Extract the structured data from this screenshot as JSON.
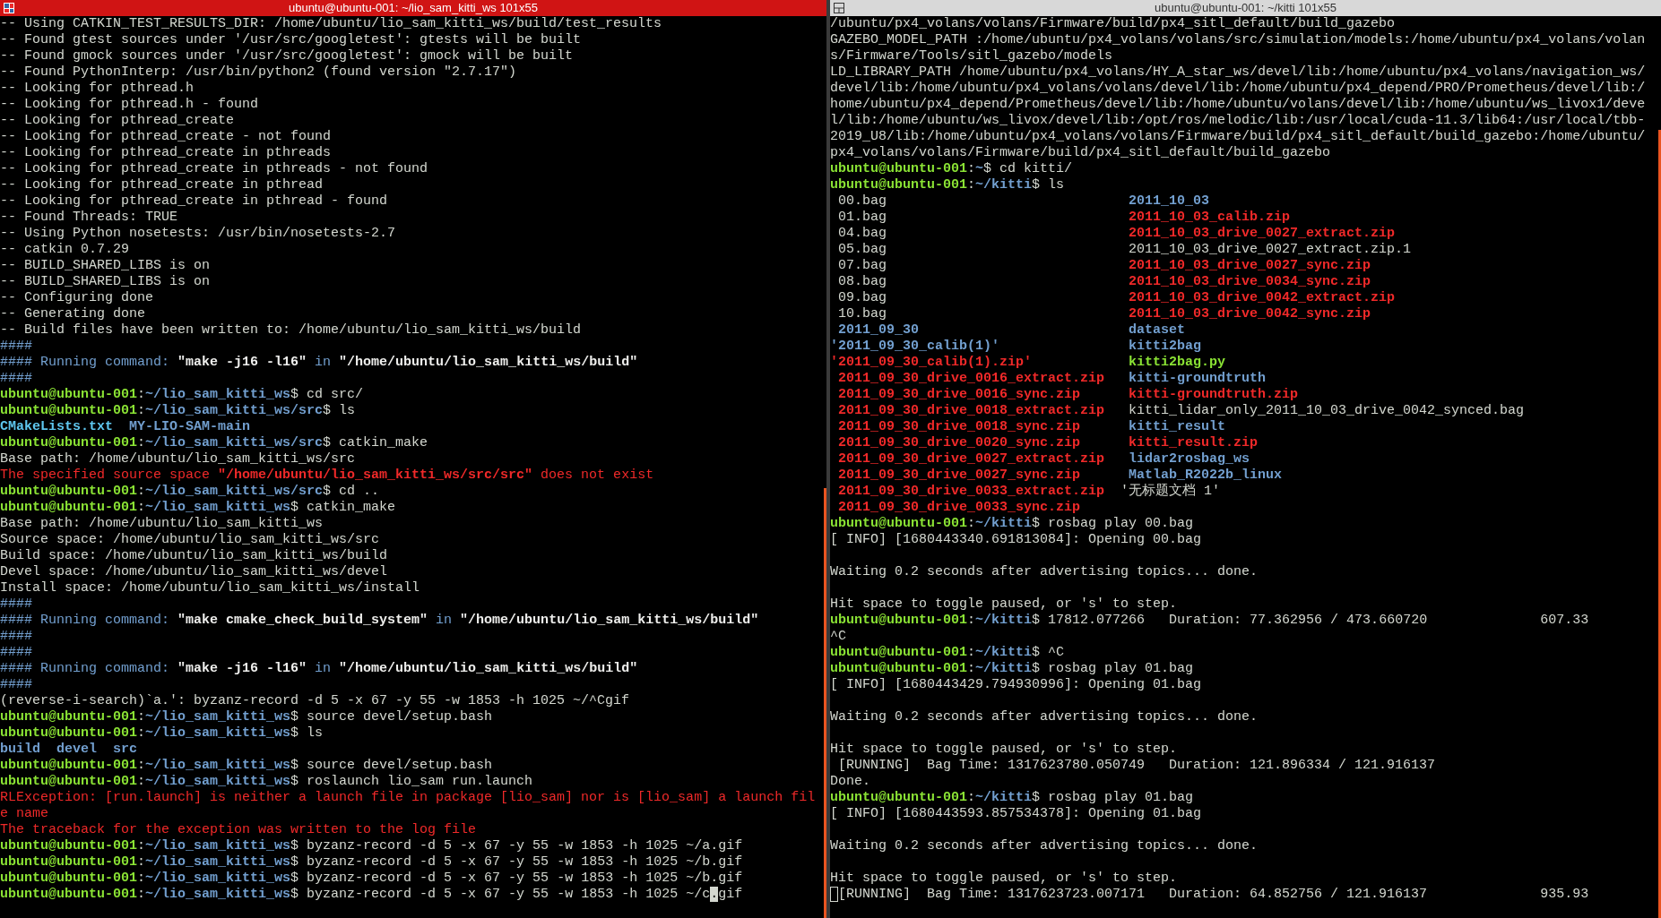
{
  "panes": [
    {
      "title": "ubuntu@ubuntu-001: ~/lio_sam_kitti_ws 101x55",
      "focused": true,
      "lines": [
        {
          "kind": "text",
          "segments": [
            {
              "text": "-- Using CATKIN_TEST_RESULTS_DIR: /home/ubuntu/lio_sam_kitti_ws/build/test_results",
              "kind": "plain"
            }
          ]
        },
        {
          "kind": "text",
          "segments": [
            {
              "text": "-- Found gtest sources under '/usr/src/googletest': gtests will be built",
              "kind": "plain"
            }
          ]
        },
        {
          "kind": "text",
          "segments": [
            {
              "text": "-- Found gmock sources under '/usr/src/googletest': gmock will be built",
              "kind": "plain"
            }
          ]
        },
        {
          "kind": "text",
          "segments": [
            {
              "text": "-- Found PythonInterp: /usr/bin/python2 (found version \"2.7.17\")",
              "kind": "plain"
            }
          ]
        },
        {
          "kind": "text",
          "segments": [
            {
              "text": "-- Looking for pthread.h",
              "kind": "plain"
            }
          ]
        },
        {
          "kind": "text",
          "segments": [
            {
              "text": "-- Looking for pthread.h - found",
              "kind": "plain"
            }
          ]
        },
        {
          "kind": "text",
          "segments": [
            {
              "text": "-- Looking for pthread_create",
              "kind": "plain"
            }
          ]
        },
        {
          "kind": "text",
          "segments": [
            {
              "text": "-- Looking for pthread_create - not found",
              "kind": "plain"
            }
          ]
        },
        {
          "kind": "text",
          "segments": [
            {
              "text": "-- Looking for pthread_create in pthreads",
              "kind": "plain"
            }
          ]
        },
        {
          "kind": "text",
          "segments": [
            {
              "text": "-- Looking for pthread_create in pthreads - not found",
              "kind": "plain"
            }
          ]
        },
        {
          "kind": "text",
          "segments": [
            {
              "text": "-- Looking for pthread_create in pthread",
              "kind": "plain"
            }
          ]
        },
        {
          "kind": "text",
          "segments": [
            {
              "text": "-- Looking for pthread_create in pthread - found",
              "kind": "plain"
            }
          ]
        },
        {
          "kind": "text",
          "segments": [
            {
              "text": "-- Found Threads: TRUE",
              "kind": "plain"
            }
          ]
        },
        {
          "kind": "text",
          "segments": [
            {
              "text": "-- Using Python nosetests: /usr/bin/nosetests-2.7",
              "kind": "plain"
            }
          ]
        },
        {
          "kind": "text",
          "segments": [
            {
              "text": "-- catkin 0.7.29",
              "kind": "plain"
            }
          ]
        },
        {
          "kind": "text",
          "segments": [
            {
              "text": "-- BUILD_SHARED_LIBS is on",
              "kind": "plain"
            }
          ]
        },
        {
          "kind": "text",
          "segments": [
            {
              "text": "-- BUILD_SHARED_LIBS is on",
              "kind": "plain"
            }
          ]
        },
        {
          "kind": "text",
          "segments": [
            {
              "text": "-- Configuring done",
              "kind": "plain"
            }
          ]
        },
        {
          "kind": "text",
          "segments": [
            {
              "text": "-- Generating done",
              "kind": "plain"
            }
          ]
        },
        {
          "kind": "text",
          "segments": [
            {
              "text": "-- Build files have been written to: /home/ubuntu/lio_sam_kitti_ws/build",
              "kind": "plain"
            }
          ]
        },
        {
          "kind": "text",
          "segments": [
            {
              "text": "####",
              "kind": "info"
            }
          ]
        },
        {
          "kind": "text",
          "segments": [
            {
              "text": "#### Running command: ",
              "kind": "info"
            },
            {
              "text": "\"make -j16 -l16\"",
              "kind": "strong"
            },
            {
              "text": " in ",
              "kind": "info"
            },
            {
              "text": "\"/home/ubuntu/lio_sam_kitti_ws/build\"",
              "kind": "strong"
            }
          ]
        },
        {
          "kind": "text",
          "segments": [
            {
              "text": "####",
              "kind": "info"
            }
          ]
        },
        {
          "kind": "prompt",
          "user": "ubuntu@ubuntu-001",
          "separator": ":",
          "path": "~/lio_sam_kitti_ws",
          "command": "$ cd src/"
        },
        {
          "kind": "prompt",
          "user": "ubuntu@ubuntu-001",
          "separator": ":",
          "path": "~/lio_sam_kitti_ws/src",
          "command": "$ ls"
        },
        {
          "kind": "text",
          "segments": [
            {
              "text": "CMakeLists.txt",
              "kind": "file"
            },
            {
              "text": "  MY-LIO-SAM-main",
              "kind": "dir"
            }
          ]
        },
        {
          "kind": "prompt",
          "user": "ubuntu@ubuntu-001",
          "separator": ":",
          "path": "~/lio_sam_kitti_ws/src",
          "command": "$ catkin_make"
        },
        {
          "kind": "text",
          "segments": [
            {
              "text": "Base path: /home/ubuntu/lio_sam_kitti_ws/src",
              "kind": "plain"
            }
          ]
        },
        {
          "kind": "text",
          "segments": [
            {
              "text": "The specified source space ",
              "kind": "error"
            },
            {
              "text": "\"/home/ubuntu/lio_sam_kitti_ws/src/src\"",
              "kind": "error_bold"
            },
            {
              "text": " does not exist",
              "kind": "error"
            }
          ]
        },
        {
          "kind": "prompt",
          "user": "ubuntu@ubuntu-001",
          "separator": ":",
          "path": "~/lio_sam_kitti_ws/src",
          "command": "$ cd .."
        },
        {
          "kind": "prompt",
          "user": "ubuntu@ubuntu-001",
          "separator": ":",
          "path": "~/lio_sam_kitti_ws",
          "command": "$ catkin_make"
        },
        {
          "kind": "text",
          "segments": [
            {
              "text": "Base path: /home/ubuntu/lio_sam_kitti_ws",
              "kind": "plain"
            }
          ]
        },
        {
          "kind": "text",
          "segments": [
            {
              "text": "Source space: /home/ubuntu/lio_sam_kitti_ws/src",
              "kind": "plain"
            }
          ]
        },
        {
          "kind": "text",
          "segments": [
            {
              "text": "Build space: /home/ubuntu/lio_sam_kitti_ws/build",
              "kind": "plain"
            }
          ]
        },
        {
          "kind": "text",
          "segments": [
            {
              "text": "Devel space: /home/ubuntu/lio_sam_kitti_ws/devel",
              "kind": "plain"
            }
          ]
        },
        {
          "kind": "text",
          "segments": [
            {
              "text": "Install space: /home/ubuntu/lio_sam_kitti_ws/install",
              "kind": "plain"
            }
          ]
        },
        {
          "kind": "text",
          "segments": [
            {
              "text": "####",
              "kind": "info"
            }
          ]
        },
        {
          "kind": "text",
          "segments": [
            {
              "text": "#### Running command: ",
              "kind": "info"
            },
            {
              "text": "\"make cmake_check_build_system\"",
              "kind": "strong"
            },
            {
              "text": " in ",
              "kind": "info"
            },
            {
              "text": "\"/home/ubuntu/lio_sam_kitti_ws/build\"",
              "kind": "strong"
            }
          ]
        },
        {
          "kind": "text",
          "segments": [
            {
              "text": "####",
              "kind": "info"
            }
          ]
        },
        {
          "kind": "text",
          "segments": [
            {
              "text": "####",
              "kind": "info"
            }
          ]
        },
        {
          "kind": "text",
          "segments": [
            {
              "text": "#### Running command: ",
              "kind": "info"
            },
            {
              "text": "\"make -j16 -l16\"",
              "kind": "strong"
            },
            {
              "text": " in ",
              "kind": "info"
            },
            {
              "text": "\"/home/ubuntu/lio_sam_kitti_ws/build\"",
              "kind": "strong"
            }
          ]
        },
        {
          "kind": "text",
          "segments": [
            {
              "text": "####",
              "kind": "info"
            }
          ]
        },
        {
          "kind": "text",
          "segments": [
            {
              "text": "(reverse-i-search)`a.': byzanz-record -d 5 -x 67 -y 55 -w 1853 -h 1025 ~/^Cgif",
              "kind": "plain"
            }
          ]
        },
        {
          "kind": "prompt",
          "user": "ubuntu@ubuntu-001",
          "separator": ":",
          "path": "~/lio_sam_kitti_ws",
          "command": "$ source devel/setup.bash"
        },
        {
          "kind": "prompt",
          "user": "ubuntu@ubuntu-001",
          "separator": ":",
          "path": "~/lio_sam_kitti_ws",
          "command": "$ ls"
        },
        {
          "kind": "text",
          "segments": [
            {
              "text": "build  devel  src",
              "kind": "dir"
            }
          ]
        },
        {
          "kind": "prompt",
          "user": "ubuntu@ubuntu-001",
          "separator": ":",
          "path": "~/lio_sam_kitti_ws",
          "command": "$ source devel/setup.bash"
        },
        {
          "kind": "prompt",
          "user": "ubuntu@ubuntu-001",
          "separator": ":",
          "path": "~/lio_sam_kitti_ws",
          "command": "$ roslaunch lio_sam run.launch"
        },
        {
          "kind": "text",
          "segments": [
            {
              "text": "RLException: [run.launch] is neither a launch file in package [lio_sam] nor is [lio_sam] a launch fil",
              "kind": "error"
            }
          ]
        },
        {
          "kind": "text",
          "segments": [
            {
              "text": "e name",
              "kind": "error"
            }
          ]
        },
        {
          "kind": "text",
          "segments": [
            {
              "text": "The traceback for the exception was written to the log file",
              "kind": "error"
            }
          ]
        },
        {
          "kind": "prompt",
          "user": "ubuntu@ubuntu-001",
          "separator": ":",
          "path": "~/lio_sam_kitti_ws",
          "command": "$ byzanz-record -d 5 -x 67 -y 55 -w 1853 -h 1025 ~/a.gif"
        },
        {
          "kind": "prompt",
          "user": "ubuntu@ubuntu-001",
          "separator": ":",
          "path": "~/lio_sam_kitti_ws",
          "command": "$ byzanz-record -d 5 -x 67 -y 55 -w 1853 -h 1025 ~/b.gif"
        },
        {
          "kind": "prompt",
          "user": "ubuntu@ubuntu-001",
          "separator": ":",
          "path": "~/lio_sam_kitti_ws",
          "command": "$ byzanz-record -d 5 -x 67 -y 55 -w 1853 -h 1025 ~/b.gif"
        },
        {
          "kind": "prompt",
          "user": "ubuntu@ubuntu-001",
          "separator": ":",
          "path": "~/lio_sam_kitti_ws",
          "command": "$ byzanz-record -d 5 -x 67 -y 55 -w 1853 -h 1025 ~/c",
          "cursor": ".",
          "after": "gif"
        }
      ]
    },
    {
      "title": "ubuntu@ubuntu-001: ~/kitti 101x55",
      "focused": false,
      "lines": [
        {
          "kind": "text",
          "segments": [
            {
              "text": "/ubuntu/px4_volans/volans/Firmware/build/px4_sitl_default/build_gazebo",
              "kind": "plain"
            }
          ]
        },
        {
          "kind": "text",
          "segments": [
            {
              "text": "GAZEBO_MODEL_PATH :/home/ubuntu/px4_volans/volans/src/simulation/models:/home/ubuntu/px4_volans/volan",
              "kind": "plain"
            }
          ]
        },
        {
          "kind": "text",
          "segments": [
            {
              "text": "s/Firmware/Tools/sitl_gazebo/models",
              "kind": "plain"
            }
          ]
        },
        {
          "kind": "text",
          "segments": [
            {
              "text": "LD_LIBRARY_PATH /home/ubuntu/px4_volans/HY_A_star_ws/devel/lib:/home/ubuntu/px4_volans/navigation_ws/",
              "kind": "plain"
            }
          ]
        },
        {
          "kind": "text",
          "segments": [
            {
              "text": "devel/lib:/home/ubuntu/px4_volans/volans/devel/lib:/home/ubuntu/px4_depend/PRO/Prometheus/devel/lib:/",
              "kind": "plain"
            }
          ]
        },
        {
          "kind": "text",
          "segments": [
            {
              "text": "home/ubuntu/px4_depend/Prometheus/devel/lib:/home/ubuntu/volans/devel/lib:/home/ubuntu/ws_livox1/deve",
              "kind": "plain"
            }
          ]
        },
        {
          "kind": "text",
          "segments": [
            {
              "text": "l/lib:/home/ubuntu/ws_livox/devel/lib:/opt/ros/melodic/lib:/usr/local/cuda-11.3/lib64:/usr/local/tbb-",
              "kind": "plain"
            }
          ]
        },
        {
          "kind": "text",
          "segments": [
            {
              "text": "2019_U8/lib:/home/ubuntu/px4_volans/volans/Firmware/build/px4_sitl_default/build_gazebo:/home/ubuntu/",
              "kind": "plain"
            }
          ]
        },
        {
          "kind": "text",
          "segments": [
            {
              "text": "px4_volans/volans/Firmware/build/px4_sitl_default/build_gazebo",
              "kind": "plain"
            }
          ]
        },
        {
          "kind": "prompt",
          "user": "ubuntu@ubuntu-001",
          "separator": ":",
          "path": "~",
          "command": "$ cd kitti/"
        },
        {
          "kind": "prompt",
          "user": "ubuntu@ubuntu-001",
          "separator": ":",
          "path": "~/kitti",
          "command": "$ ls"
        },
        {
          "kind": "ls",
          "left": {
            "text": " 00.bag",
            "kind": "plain"
          },
          "right": {
            "text": " 2011_10_03",
            "kind": "dir"
          }
        },
        {
          "kind": "ls",
          "left": {
            "text": " 01.bag",
            "kind": "plain"
          },
          "right": {
            "text": " 2011_10_03_calib.zip",
            "kind": "zip"
          }
        },
        {
          "kind": "ls",
          "left": {
            "text": " 04.bag",
            "kind": "plain"
          },
          "right": {
            "text": " 2011_10_03_drive_0027_extract.zip",
            "kind": "zip"
          }
        },
        {
          "kind": "ls",
          "left": {
            "text": " 05.bag",
            "kind": "plain"
          },
          "right": {
            "text": " 2011_10_03_drive_0027_extract.zip.1",
            "kind": "plain"
          }
        },
        {
          "kind": "ls",
          "left": {
            "text": " 07.bag",
            "kind": "plain"
          },
          "right": {
            "text": " 2011_10_03_drive_0027_sync.zip",
            "kind": "zip"
          }
        },
        {
          "kind": "ls",
          "left": {
            "text": " 08.bag",
            "kind": "plain"
          },
          "right": {
            "text": " 2011_10_03_drive_0034_sync.zip",
            "kind": "zip"
          }
        },
        {
          "kind": "ls",
          "left": {
            "text": " 09.bag",
            "kind": "plain"
          },
          "right": {
            "text": " 2011_10_03_drive_0042_extract.zip",
            "kind": "zip"
          }
        },
        {
          "kind": "ls",
          "left": {
            "text": " 10.bag",
            "kind": "plain"
          },
          "right": {
            "text": " 2011_10_03_drive_0042_sync.zip",
            "kind": "zip"
          }
        },
        {
          "kind": "ls",
          "left": {
            "text": " 2011_09_30",
            "kind": "dir"
          },
          "right": {
            "text": " dataset",
            "kind": "dir"
          }
        },
        {
          "kind": "ls",
          "left": {
            "text": "'2011_09_30_calib(1)'",
            "kind": "dir"
          },
          "right": {
            "text": " kitti2bag",
            "kind": "dir"
          }
        },
        {
          "kind": "ls",
          "left": {
            "text": "'2011_09_30_calib(1).zip'",
            "kind": "zip"
          },
          "right": {
            "text": " kitti2bag.py",
            "kind": "exec"
          }
        },
        {
          "kind": "ls",
          "left": {
            "text": " 2011_09_30_drive_0016_extract.zip",
            "kind": "zip"
          },
          "right": {
            "text": " kitti-groundtruth",
            "kind": "dir"
          }
        },
        {
          "kind": "ls",
          "left": {
            "text": " 2011_09_30_drive_0016_sync.zip",
            "kind": "zip"
          },
          "right": {
            "text": " kitti-groundtruth.zip",
            "kind": "zip"
          }
        },
        {
          "kind": "ls",
          "left": {
            "text": " 2011_09_30_drive_0018_extract.zip",
            "kind": "zip"
          },
          "right": {
            "text": " kitti_lidar_only_2011_10_03_drive_0042_synced.bag",
            "kind": "plain"
          }
        },
        {
          "kind": "ls",
          "left": {
            "text": " 2011_09_30_drive_0018_sync.zip",
            "kind": "zip"
          },
          "right": {
            "text": " kitti_result",
            "kind": "dir"
          }
        },
        {
          "kind": "ls",
          "left": {
            "text": " 2011_09_30_drive_0020_sync.zip",
            "kind": "zip"
          },
          "right": {
            "text": " kitti_result.zip",
            "kind": "zip"
          }
        },
        {
          "kind": "ls",
          "left": {
            "text": " 2011_09_30_drive_0027_extract.zip",
            "kind": "zip"
          },
          "right": {
            "text": " lidar2rosbag_ws",
            "kind": "dir"
          }
        },
        {
          "kind": "ls",
          "left": {
            "text": " 2011_09_30_drive_0027_sync.zip",
            "kind": "zip"
          },
          "right": {
            "text": " Matlab_R2022b_linux",
            "kind": "dir"
          }
        },
        {
          "kind": "ls",
          "left": {
            "text": " 2011_09_30_drive_0033_extract.zip",
            "kind": "zip"
          },
          "right": {
            "text": "'无标题文档 1'",
            "kind": "plain"
          }
        },
        {
          "kind": "ls",
          "left": {
            "text": " 2011_09_30_drive_0033_sync.zip",
            "kind": "zip"
          }
        },
        {
          "kind": "prompt",
          "user": "ubuntu@ubuntu-001",
          "separator": ":",
          "path": "~/kitti",
          "command": "$ rosbag play 00.bag"
        },
        {
          "kind": "text",
          "segments": [
            {
              "text": "[ INFO] [1680443340.691813084]: Opening 00.bag",
              "kind": "plain"
            }
          ]
        },
        {
          "kind": "blank"
        },
        {
          "kind": "text",
          "segments": [
            {
              "text": "Waiting 0.2 seconds after advertising topics... done.",
              "kind": "plain"
            }
          ]
        },
        {
          "kind": "blank"
        },
        {
          "kind": "text",
          "segments": [
            {
              "text": "Hit space to toggle paused, or 's' to step.",
              "kind": "plain"
            }
          ]
        },
        {
          "kind": "prompt",
          "user": "ubuntu@ubuntu-001",
          "separator": ":",
          "path": "~/kitti",
          "command": "$ 17812.077266   Duration: 77.362956 / 473.660720              607.33"
        },
        {
          "kind": "text",
          "segments": [
            {
              "text": "^C",
              "kind": "plain"
            }
          ]
        },
        {
          "kind": "prompt",
          "user": "ubuntu@ubuntu-001",
          "separator": ":",
          "path": "~/kitti",
          "command": "$ ^C"
        },
        {
          "kind": "prompt",
          "user": "ubuntu@ubuntu-001",
          "separator": ":",
          "path": "~/kitti",
          "command": "$ rosbag play 01.bag"
        },
        {
          "kind": "text",
          "segments": [
            {
              "text": "[ INFO] [1680443429.794930996]: Opening 01.bag",
              "kind": "plain"
            }
          ]
        },
        {
          "kind": "blank"
        },
        {
          "kind": "text",
          "segments": [
            {
              "text": "Waiting 0.2 seconds after advertising topics... done.",
              "kind": "plain"
            }
          ]
        },
        {
          "kind": "blank"
        },
        {
          "kind": "text",
          "segments": [
            {
              "text": "Hit space to toggle paused, or 's' to step.",
              "kind": "plain"
            }
          ]
        },
        {
          "kind": "text",
          "segments": [
            {
              "text": " [RUNNING]  Bag Time: 1317623780.050749   Duration: 121.896334 / 121.916137",
              "kind": "plain"
            }
          ]
        },
        {
          "kind": "text",
          "segments": [
            {
              "text": "Done.",
              "kind": "plain"
            }
          ]
        },
        {
          "kind": "prompt",
          "user": "ubuntu@ubuntu-001",
          "separator": ":",
          "path": "~/kitti",
          "command": "$ rosbag play 01.bag"
        },
        {
          "kind": "text",
          "segments": [
            {
              "text": "[ INFO] [1680443593.857534378]: Opening 01.bag",
              "kind": "plain"
            }
          ]
        },
        {
          "kind": "blank"
        },
        {
          "kind": "text",
          "segments": [
            {
              "text": "Waiting 0.2 seconds after advertising topics... done.",
              "kind": "plain"
            }
          ]
        },
        {
          "kind": "blank"
        },
        {
          "kind": "text",
          "segments": [
            {
              "text": "Hit space to toggle paused, or 's' to step.",
              "kind": "plain"
            }
          ]
        },
        {
          "kind": "text",
          "segments": [
            {
              "text": "[RUNNING]  Bag Time: 1317623723.007171   Duration: 64.852756 / 121.916137              935.93",
              "kind": "plain"
            }
          ],
          "cursor_before": true
        }
      ]
    }
  ]
}
